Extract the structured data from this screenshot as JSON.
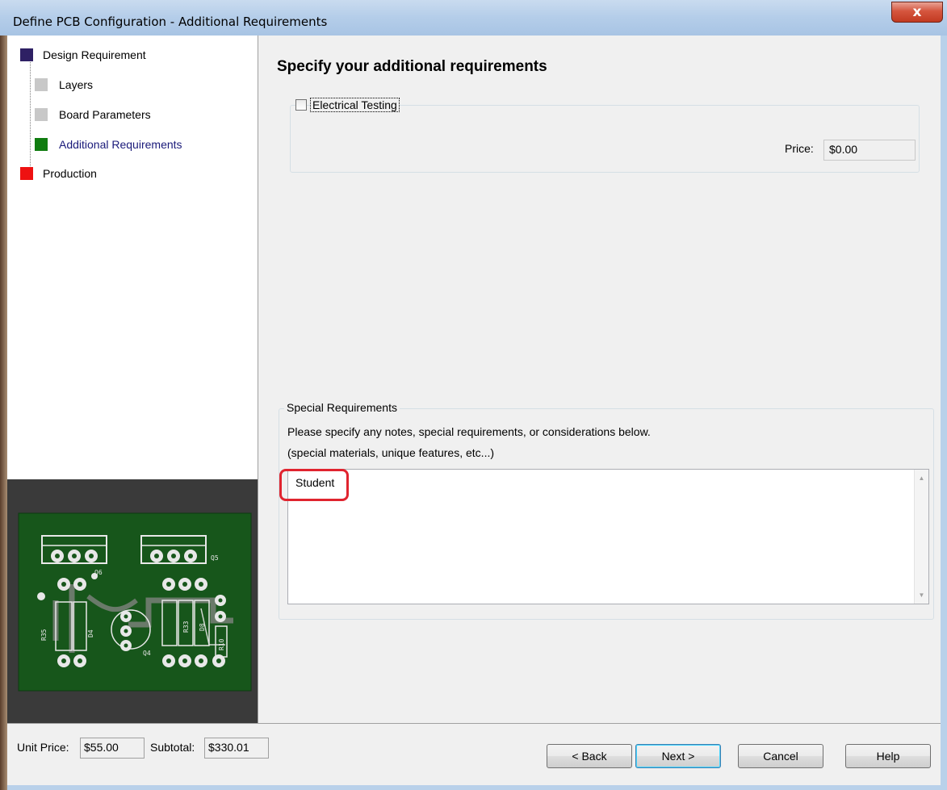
{
  "window": {
    "title": "Define PCB Configuration - Additional Requirements",
    "close_glyph": "x"
  },
  "tree": {
    "items": [
      {
        "label": "Design Requirement",
        "color": "#2e2064"
      },
      {
        "label": "Layers",
        "color": "#c8c8c8"
      },
      {
        "label": "Board Parameters",
        "color": "#c8c8c8"
      },
      {
        "label": "Additional Requirements",
        "color": "#107c10"
      },
      {
        "label": "Production",
        "color": "#ee1111"
      }
    ]
  },
  "main": {
    "heading": "Specify your additional requirements",
    "electrical_testing": {
      "label": "Electrical Testing",
      "checked": false,
      "price_label": "Price:",
      "price_value": "$0.00"
    },
    "special": {
      "legend": "Special Requirements",
      "line1": "Please specify any notes, special requirements, or considerations below.",
      "line2": "(special materials, unique features, etc...)",
      "text": "Student"
    }
  },
  "pcb_preview": {
    "labels": [
      "Q6",
      "Q5",
      "R35",
      "D4",
      "Q4",
      "R33",
      "D8",
      "R10"
    ]
  },
  "footer": {
    "unit_price_label": "Unit Price:",
    "unit_price_value": "$55.00",
    "subtotal_label": "Subtotal:",
    "subtotal_value": "$330.01",
    "buttons": {
      "back": "< Back",
      "next": "Next >",
      "cancel": "Cancel",
      "help": "Help"
    }
  },
  "colors": {
    "pcb_green": "#17561b",
    "highlight": "#e0242f"
  }
}
